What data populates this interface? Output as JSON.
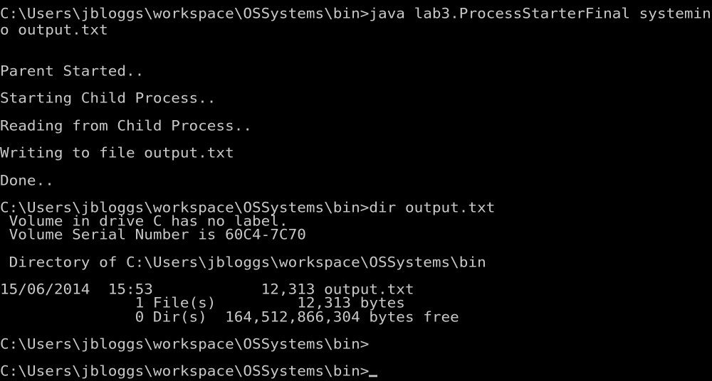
{
  "window": {
    "type": "command-prompt",
    "text_color": "#c8c8c8",
    "background_color": "#000000"
  },
  "lines": [
    "C:\\Users\\jbloggs\\workspace\\OSSystems\\bin>java lab3.ProcessStarterFinal systemin",
    "o output.txt",
    "",
    "",
    "Parent Started..",
    "",
    "Starting Child Process..",
    "",
    "Reading from Child Process..",
    "",
    "Writing to file output.txt",
    "",
    "Done..",
    "",
    "C:\\Users\\jbloggs\\workspace\\OSSystems\\bin>dir output.txt",
    " Volume in drive C has no label.",
    " Volume Serial Number is 60C4-7C70",
    "",
    " Directory of C:\\Users\\jbloggs\\workspace\\OSSystems\\bin",
    "",
    "15/06/2014  15:53            12,313 output.txt",
    "               1 File(s)         12,313 bytes",
    "               0 Dir(s)  164,512,866,304 bytes free",
    "",
    "C:\\Users\\jbloggs\\workspace\\OSSystems\\bin>",
    "",
    "C:\\Users\\jbloggs\\workspace\\OSSystems\\bin>"
  ]
}
